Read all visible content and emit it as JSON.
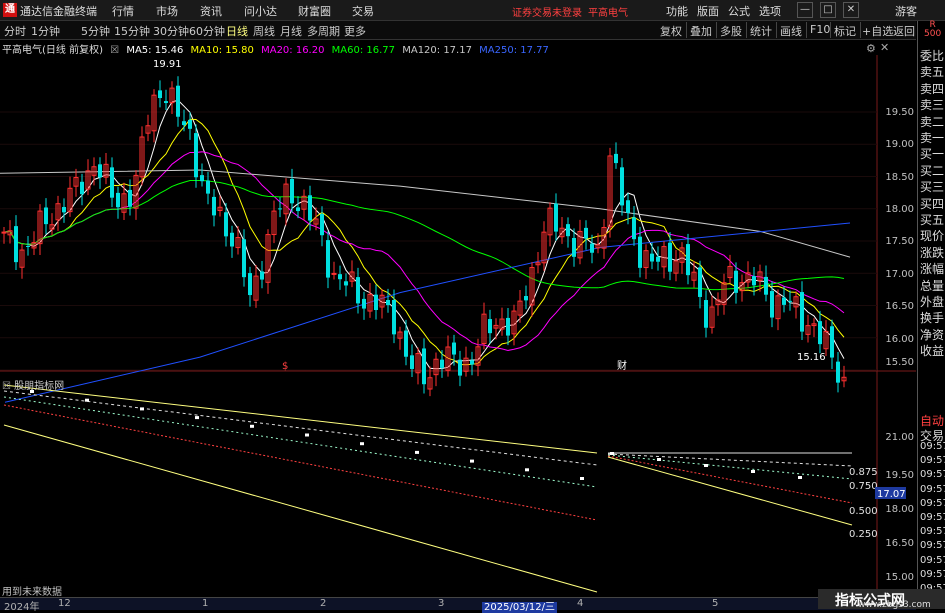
{
  "app": {
    "logo": "通",
    "title": "通达信金融终端"
  },
  "menu": [
    "行情",
    "市场",
    "资讯",
    "问小达",
    "财富圈",
    "交易"
  ],
  "status": {
    "broker": "证券交易未登录",
    "stock": "平高电气"
  },
  "right_menu": [
    "功能",
    "版面",
    "公式",
    "选项"
  ],
  "guest": "游客",
  "window_buttons": [
    "—",
    "□",
    "✕"
  ],
  "periods": [
    "分时",
    "1分钟",
    "5分钟",
    "15分钟",
    "30分钟",
    "60分钟",
    "日线",
    "周线",
    "月线",
    "多周期",
    "更多"
  ],
  "active_period": "日线",
  "tools": [
    "复权",
    "叠加",
    "多股",
    "统计",
    "画线",
    "F10",
    "标记",
    "+自选",
    "返回"
  ],
  "chart_title": "平高电气(日线 前复权)",
  "ma_legend": [
    {
      "label": "MA5: 15.46",
      "color": "#ffffff"
    },
    {
      "label": "MA10: 15.80",
      "color": "#ffff00"
    },
    {
      "label": "MA20: 16.20",
      "color": "#ff00ff"
    },
    {
      "label": "MA60: 16.77",
      "color": "#00ff00"
    },
    {
      "label": "MA120: 17.17",
      "color": "#c8c8c8"
    },
    {
      "label": "MA250: 17.77",
      "color": "#2050ff"
    }
  ],
  "price_axis": [
    "19.50",
    "19.00",
    "18.50",
    "18.00",
    "17.50",
    "17.00",
    "16.50",
    "16.00",
    "15.50"
  ],
  "annotations": {
    "high": "19.91",
    "low": "15.16",
    "marker_1": "$",
    "marker_2": "财"
  },
  "indicator": {
    "name": "股朋指标网",
    "axis": [
      "21.00",
      "19.50",
      "18.00",
      "16.50",
      "15.00"
    ],
    "fib_labels": [
      "0.875",
      "0.750",
      "0.500",
      "0.250"
    ],
    "current_value": "17.07"
  },
  "side_panel": {
    "r_label": "R\n500",
    "items": [
      "委比",
      "卖五",
      "卖四",
      "卖三",
      "卖二",
      "卖一",
      "买一",
      "买二",
      "买三",
      "买四",
      "买五",
      "现价",
      "涨跌",
      "涨幅",
      "总量",
      "外盘",
      "换手",
      "净资",
      "收益"
    ],
    "trade_items": [
      "自动",
      "交易"
    ],
    "times": [
      "09:57",
      "09:57",
      "09:57",
      "09:57",
      "09:57",
      "09:57",
      "09:57",
      "09:57",
      "09:57",
      "09:57",
      "09:57",
      "09:57"
    ]
  },
  "x_axis": [
    "2024年",
    "12",
    "1",
    "2",
    "3",
    "2025/03/12/三",
    "4",
    "5"
  ],
  "future_data": "用到未来数据",
  "watermark": {
    "title": "指标公式网",
    "url": "www.zbgs3.com"
  },
  "colors": {
    "up": "#ff3030",
    "down": "#00e0e0",
    "ma5": "#ffffff",
    "ma10": "#ffff00",
    "ma20": "#ff00ff",
    "ma60": "#00ff00",
    "ma120": "#c8c8c8",
    "ma250": "#2050ff"
  }
}
